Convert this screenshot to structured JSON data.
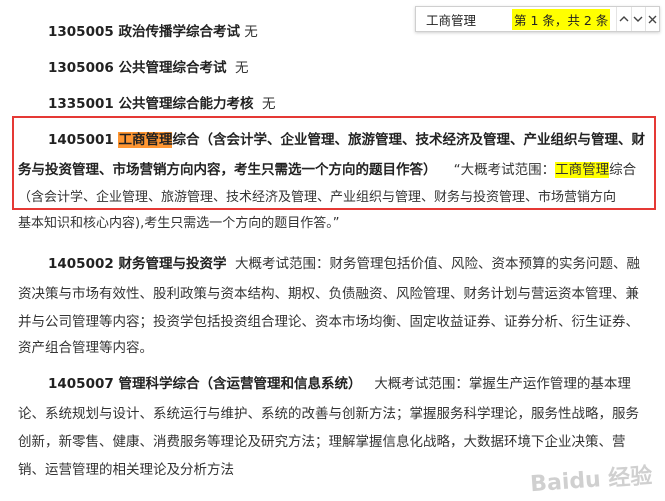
{
  "find_bar": {
    "query": "工商管理",
    "result_count": "第 1 条，共 2 条",
    "prev_icon": "chevron-up-icon",
    "next_icon": "chevron-down-icon",
    "close_icon": "close-icon"
  },
  "entries": {
    "e1305005": {
      "code_title": "1305005 政治传播学综合考试",
      "note": "无"
    },
    "e1305006": {
      "code_title": "1305006 公共管理综合考试",
      "note": "无"
    },
    "e1335001": {
      "code_title": "1335001 公共管理综合能力考核",
      "note": "无"
    },
    "e1405001": {
      "code": "1405001 ",
      "title_hl": "工商管理",
      "title_rest_l1": "综合（含会计学、企业管理、旅游管理、技术经济及管理、产业组织与管理、财",
      "title_rest_l2": "务与投资管理、市场营销方向内容，考生只需选一个方向的题目作答）",
      "desc_open": "“大概考试范围：",
      "desc_hl": "工商管理",
      "desc_rest_l2": "综合",
      "desc_l3": "（含会计学、企业管理、旅游管理、技术经济及管理、产业组织与管理、财务与投资管理、市场营销方向",
      "desc_l4": "基本知识和核心内容),考生只需选一个方向的题目作答。”"
    },
    "e1405002": {
      "code_title": "1405002 财务管理与投资学",
      "l1": "大概考试范围：财务管理包括价值、风险、资本预算的实务问题、融",
      "l2": "资决策与市场有效性、股利政策与资本结构、期权、负债融资、风险管理、财务计划与营运资本管理、兼",
      "l3": "并与公司管理等内容；投资学包括投资组合理论、资本市场均衡、固定收益证券、证券分析、衍生证券、",
      "l4": "资产组合管理等内容。"
    },
    "e1405007": {
      "code_title": "1405007 管理科学综合（含运营管理和信息系统）",
      "l1": "大概考试范围：掌握生产运作管理的基本理",
      "l2": "论、系统规划与设计、系统运行与维护、系统的改善与创新方法；掌握服务科学理论，服务性战略，服务",
      "l3": "创新，新零售、健康、消费服务等理论及研究方法；理解掌握信息化战略，大数据环境下企业决策、营",
      "l4": "销、运营管理的相关理论及分析方法"
    }
  },
  "watermark": "Baidu 经验",
  "colors": {
    "current_match": "#ff9632",
    "other_match": "#ffff00",
    "box": "#e53935"
  }
}
